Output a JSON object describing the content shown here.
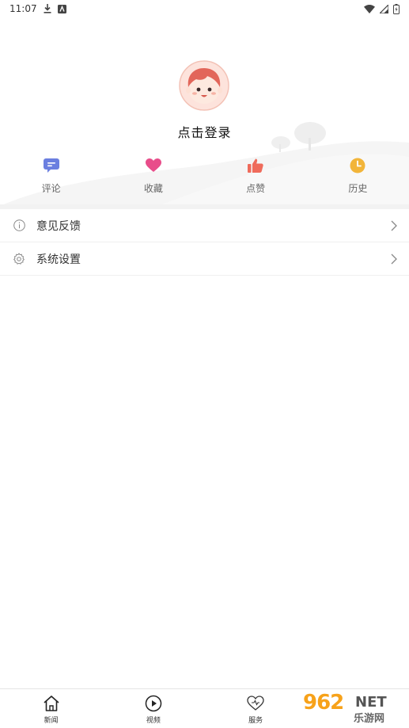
{
  "status_bar": {
    "time": "11:07"
  },
  "profile": {
    "login_text": "点击登录"
  },
  "quick_actions": [
    {
      "label": "评论",
      "icon": "comment-icon",
      "color": "#6b7fe0"
    },
    {
      "label": "收藏",
      "icon": "heart-icon",
      "color": "#e84d8a"
    },
    {
      "label": "点赞",
      "icon": "thumbs-up-icon",
      "color": "#ef6b5b"
    },
    {
      "label": "历史",
      "icon": "clock-icon",
      "color": "#f2b53a"
    }
  ],
  "menu": [
    {
      "label": "意见反馈",
      "icon": "info-icon"
    },
    {
      "label": "系统设置",
      "icon": "gear-icon"
    }
  ],
  "bottom_nav": [
    {
      "label": "新闻",
      "icon": "home-icon"
    },
    {
      "label": "视频",
      "icon": "play-icon"
    },
    {
      "label": "服务",
      "icon": "heart-outline-icon"
    }
  ],
  "watermark": {
    "number": "962",
    "suffix": "NET",
    "subtitle": "乐游网"
  }
}
